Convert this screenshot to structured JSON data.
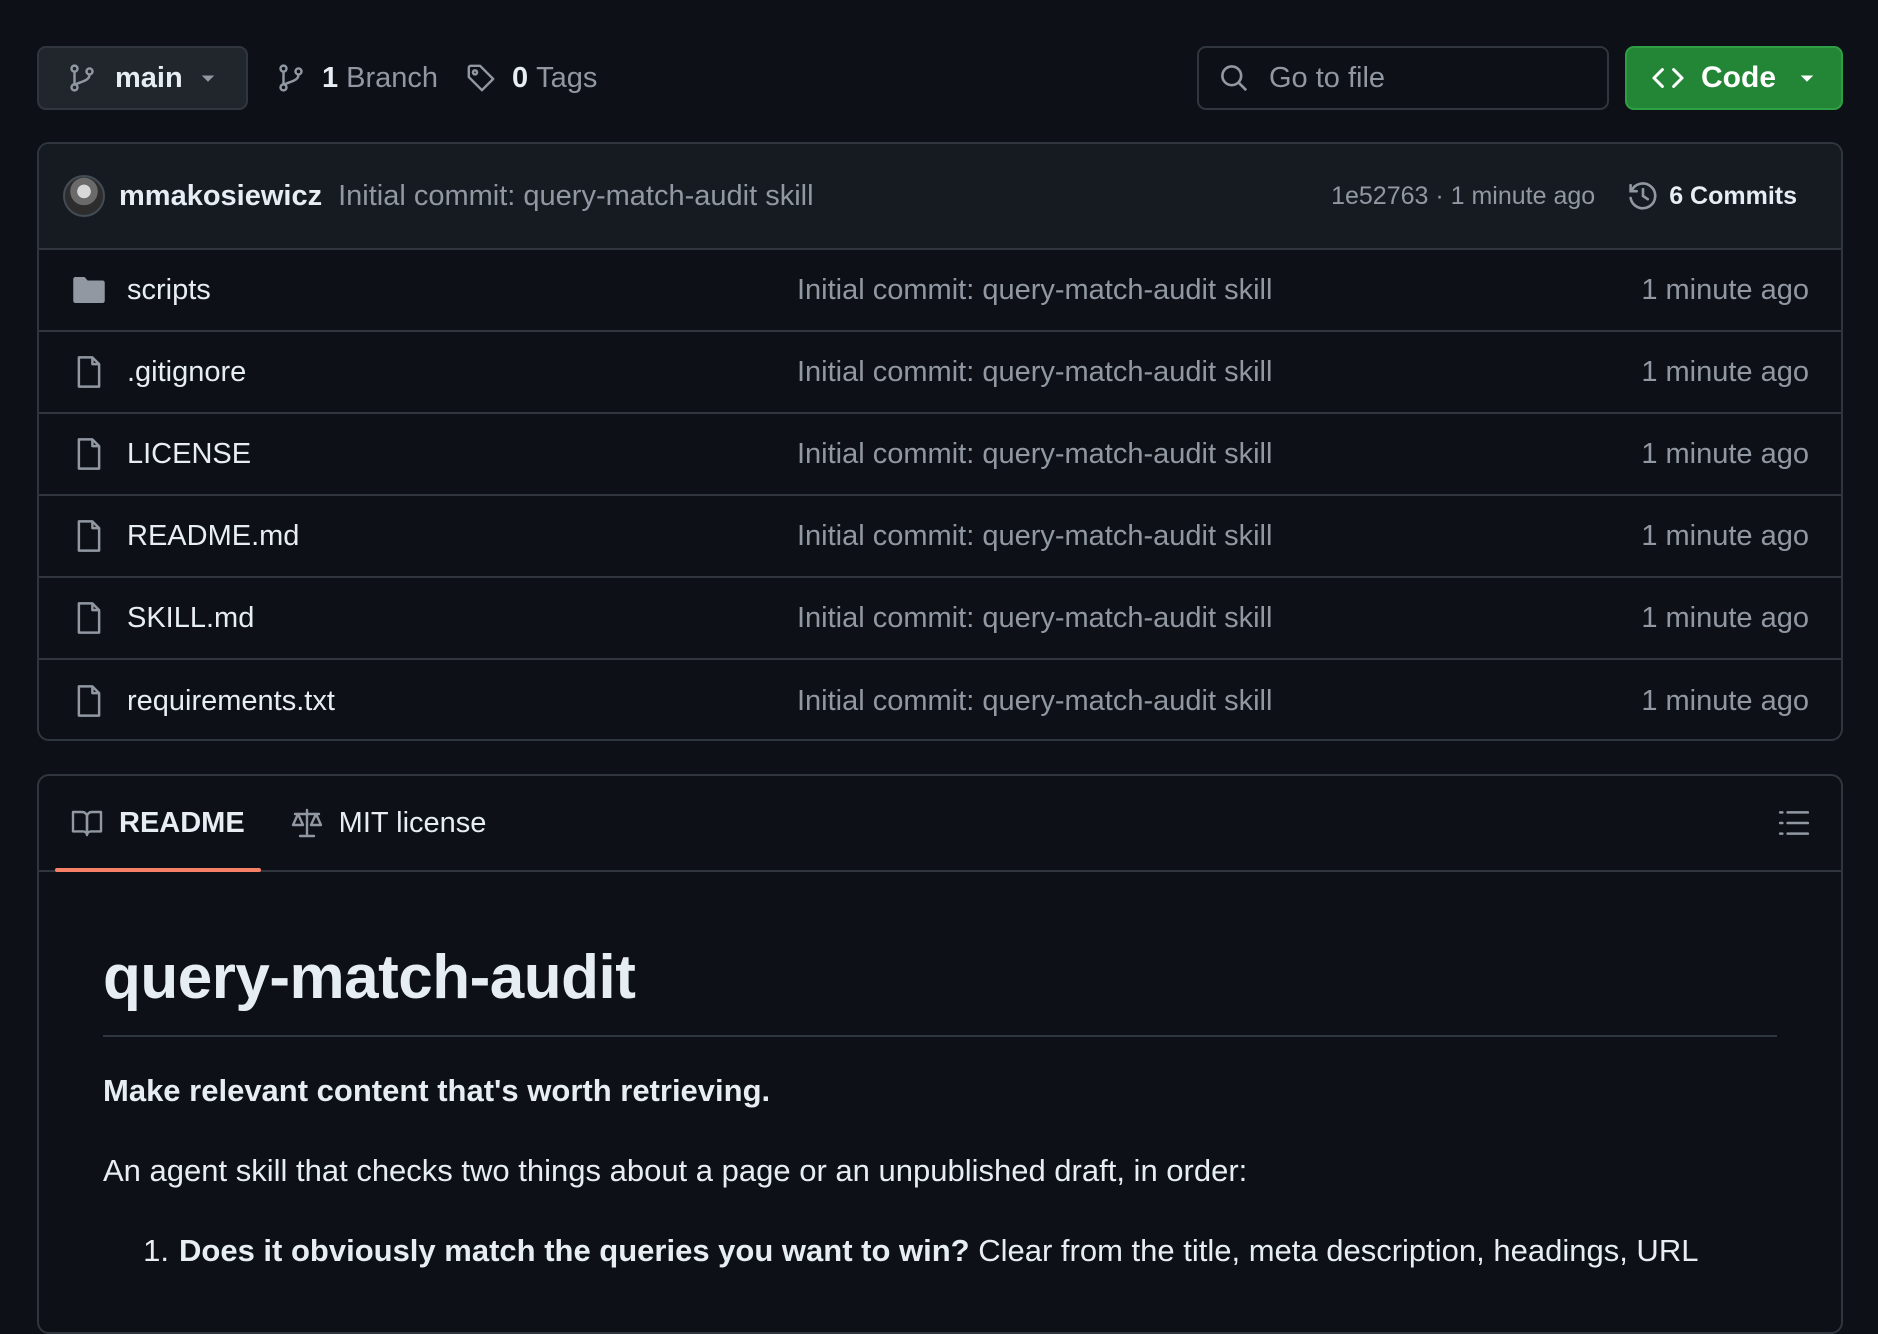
{
  "toolbar": {
    "branch": "main",
    "branch_count": "1",
    "branch_label": "Branch",
    "tag_count": "0",
    "tag_label": "Tags",
    "search_placeholder": "Go to file",
    "code_label": "Code"
  },
  "latest_commit": {
    "author": "mmakosiewicz",
    "message": "Initial commit: query-match-audit skill",
    "hash_time": "1e52763 · 1 minute ago",
    "commits_label": "6 Commits"
  },
  "files": [
    {
      "name": "scripts",
      "type": "folder",
      "message": "Initial commit: query-match-audit skill",
      "age": "1 minute ago"
    },
    {
      "name": ".gitignore",
      "type": "file",
      "message": "Initial commit: query-match-audit skill",
      "age": "1 minute ago"
    },
    {
      "name": "LICENSE",
      "type": "file",
      "message": "Initial commit: query-match-audit skill",
      "age": "1 minute ago"
    },
    {
      "name": "README.md",
      "type": "file",
      "message": "Initial commit: query-match-audit skill",
      "age": "1 minute ago"
    },
    {
      "name": "SKILL.md",
      "type": "file",
      "message": "Initial commit: query-match-audit skill",
      "age": "1 minute ago"
    },
    {
      "name": "requirements.txt",
      "type": "file",
      "message": "Initial commit: query-match-audit skill",
      "age": "1 minute ago"
    }
  ],
  "readme": {
    "tabs": [
      {
        "label": "README",
        "icon": "book-icon"
      },
      {
        "label": "MIT license",
        "icon": "scale-icon"
      }
    ],
    "title": "query-match-audit",
    "tagline": "Make relevant content that's worth retrieving.",
    "intro": "An agent skill that checks two things about a page or an unpublished draft, in order:",
    "step1_num": "1.",
    "step1_bold": "Does it obviously match the queries you want to win?",
    "step1_rest": " Clear from the title, meta description, headings, URL"
  },
  "colors": {
    "background": "#0d1117",
    "panel": "#161b22",
    "border": "#30363d",
    "muted_text": "#9198a1",
    "accent_green": "#238636",
    "tab_underline": "#f78166"
  }
}
